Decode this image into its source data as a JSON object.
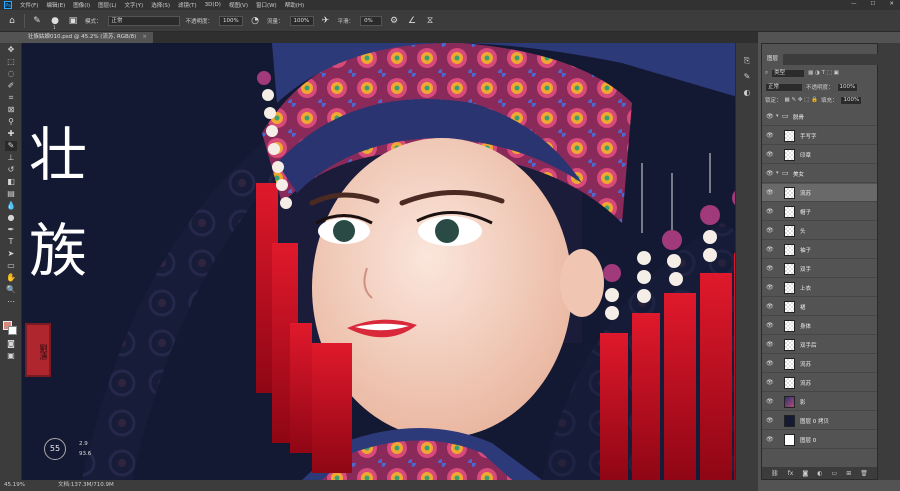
{
  "menubar": {
    "logo": "Ps",
    "items": [
      "文件(F)",
      "编辑(E)",
      "图像(I)",
      "图层(L)",
      "文字(Y)",
      "选择(S)",
      "滤镜(T)",
      "3D(D)",
      "视图(V)",
      "窗口(W)",
      "帮助(H)"
    ],
    "window_controls": [
      "—",
      "☐",
      "✕"
    ]
  },
  "options": {
    "brush_size": "1",
    "mode_label": "模式：",
    "mode_value": "正常",
    "opacity_label": "不透明度：",
    "opacity_value": "100%",
    "flow_label": "流量：",
    "flow_value": "100%",
    "smooth_label": "平滑：",
    "smooth_value": "0%"
  },
  "document": {
    "tab_title": "壮族姑娘010.psd @ 45.2% (流苏, RGB/8)",
    "close": "×"
  },
  "status": {
    "zoom": "45.19%",
    "doc_size": "文档:137.3M/710.9M"
  },
  "artwork": {
    "title_chars": "壮族",
    "seal_text": "劉濤",
    "hud_value": "55",
    "hud_line1": "2.9",
    "hud_line2": "93.6"
  },
  "panel": {
    "tab_label": "图层",
    "filter_label": "类型",
    "blend_mode": "正常",
    "opacity_label": "不透明度：",
    "opacity_value": "100%",
    "lock_label": "锁定：",
    "fill_label": "填充：",
    "fill_value": "100%",
    "layers": [
      {
        "name": "脱骨",
        "kind": "group"
      },
      {
        "name": "手写字",
        "kind": "layer",
        "thumb": "checker"
      },
      {
        "name": "印章",
        "kind": "layer",
        "thumb": "checker"
      },
      {
        "name": "美女",
        "kind": "group"
      },
      {
        "name": "流苏",
        "kind": "layer",
        "thumb": "checker",
        "selected": true
      },
      {
        "name": "帽子",
        "kind": "layer",
        "thumb": "checker"
      },
      {
        "name": "头",
        "kind": "layer",
        "thumb": "checker"
      },
      {
        "name": "袖子",
        "kind": "layer",
        "thumb": "checker"
      },
      {
        "name": "双手",
        "kind": "layer",
        "thumb": "checker"
      },
      {
        "name": "上衣",
        "kind": "layer",
        "thumb": "checker"
      },
      {
        "name": "裙",
        "kind": "layer",
        "thumb": "checker"
      },
      {
        "name": "身体",
        "kind": "layer",
        "thumb": "checker"
      },
      {
        "name": "双手后",
        "kind": "layer",
        "thumb": "checker"
      },
      {
        "name": "流苏",
        "kind": "layer",
        "thumb": "checker"
      },
      {
        "name": "流苏",
        "kind": "layer",
        "thumb": "checker"
      },
      {
        "name": "影",
        "kind": "layer",
        "thumb": "img"
      },
      {
        "name": "图层 0 拷贝",
        "kind": "layer",
        "thumb": "dark"
      },
      {
        "name": "图层 0",
        "kind": "layer",
        "thumb": "white"
      }
    ]
  },
  "colors": {
    "canvas_bg": "#151a34",
    "ps_blue": "#31a8ff",
    "tassel_red": "#c30a1c",
    "hat_blue": "#2d3a7a"
  }
}
